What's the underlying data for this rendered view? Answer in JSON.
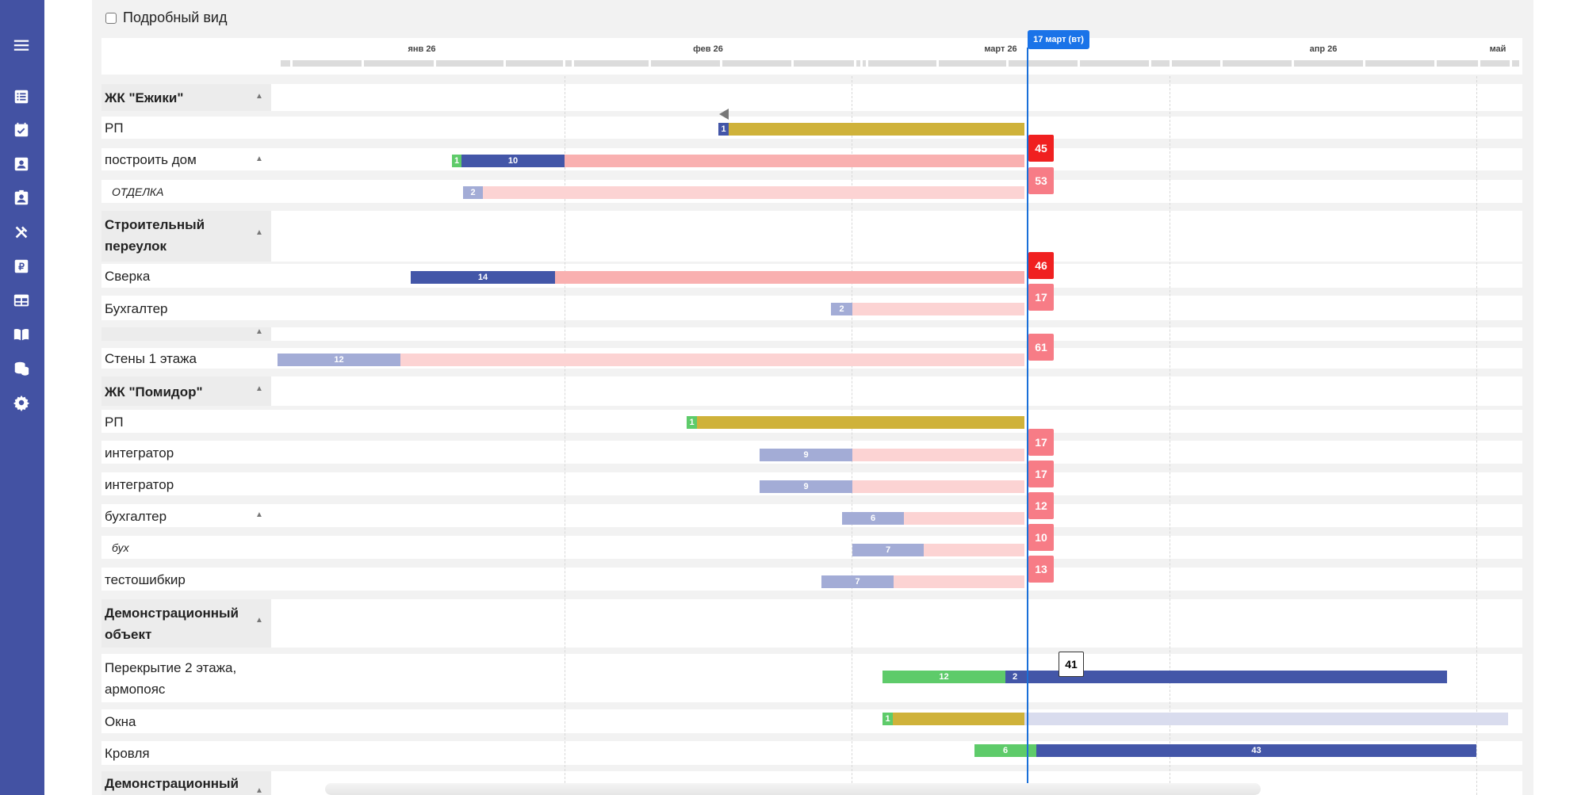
{
  "sidebar": {
    "icons": [
      "menu-icon",
      "list-icon",
      "calendar-check-icon",
      "user-icon",
      "contacts-icon",
      "tools-icon",
      "ruble-icon",
      "table-icon",
      "book-icon",
      "coins-icon",
      "gear-icon"
    ]
  },
  "toolbar": {
    "detail_label": "Подробный вид",
    "detail_checked": false
  },
  "timeline": {
    "months": [
      "янв 26",
      "фев 26",
      "март 26",
      "апр 26",
      "май"
    ],
    "today_label": "17 март (вт)"
  },
  "colors": {
    "sidebar": "#4352a3",
    "today": "#1a73e8",
    "dark_blue": "#4356a8",
    "light_blue": "#a3acd6",
    "green": "#5ecb6a",
    "gold": "#cfb23a",
    "red_bar": "#f9b0b0",
    "pink_bar": "#fcd3d3",
    "marker_red": "#f02020",
    "marker_pink": "#f77c86",
    "lavender": "#d9dcee"
  },
  "rows": [
    {
      "label": "ЖК \"Ежики\"",
      "type": "group"
    },
    {
      "label": "РП",
      "type": "task"
    },
    {
      "label": "построить дом",
      "type": "task"
    },
    {
      "label": "ОТДЕЛКА",
      "type": "sub"
    },
    {
      "label": "Строительный",
      "label2": "переулок",
      "type": "group"
    },
    {
      "label": "Сверка",
      "type": "task"
    },
    {
      "label": "Бухгалтер",
      "type": "task"
    },
    {
      "label": "",
      "type": "group"
    },
    {
      "label": "Стены 1 этажа",
      "type": "task"
    },
    {
      "label": "ЖК \"Помидор\"",
      "type": "group"
    },
    {
      "label": "РП",
      "type": "task"
    },
    {
      "label": "интегратор",
      "type": "task"
    },
    {
      "label": "интегратор",
      "type": "task"
    },
    {
      "label": "бухгалтер",
      "type": "task"
    },
    {
      "label": "бух",
      "type": "sub"
    },
    {
      "label": "тестошибкир",
      "type": "task"
    },
    {
      "label": "Демонстрационный",
      "label2": "объект",
      "type": "group"
    },
    {
      "label": "Перекрытие 2 этажа,",
      "label2": "армопояс",
      "type": "task"
    },
    {
      "label": "Окна",
      "type": "task"
    },
    {
      "label": "Кровля",
      "type": "task"
    },
    {
      "label": "Демонстрационный",
      "type": "group"
    }
  ],
  "bar_texts": [
    "1",
    "1",
    "10",
    "2",
    "14",
    "2",
    "12",
    "1",
    "9",
    "9",
    "6",
    "7",
    "7",
    "12",
    "2",
    "1",
    "6",
    "43"
  ],
  "markers": [
    "45",
    "53",
    "46",
    "17",
    "61",
    "17",
    "17",
    "12",
    "10",
    "13",
    "41"
  ]
}
